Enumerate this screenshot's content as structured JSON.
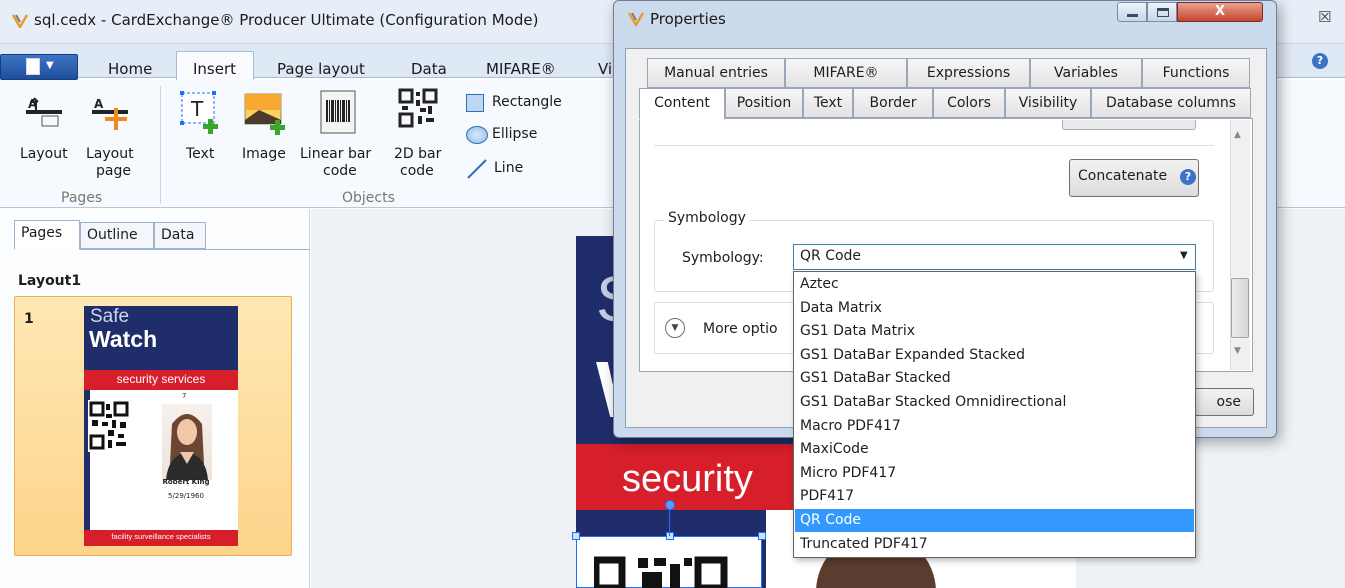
{
  "window": {
    "title": "sql.cedx - CardExchange® Producer Ultimate (Configuration Mode)"
  },
  "ribbon": {
    "tabs": [
      "Home",
      "Insert",
      "Page layout",
      "Data",
      "MIFARE®",
      "Vi"
    ],
    "active_tab": "Insert",
    "pages_group": {
      "label": "Pages",
      "layout": "Layout",
      "layout_page_1": "Layout",
      "layout_page_2": "page"
    },
    "objects_group": {
      "label": "Objects",
      "text": "Text",
      "image": "Image",
      "linear_1": "Linear bar",
      "linear_2": "code",
      "bar2d_1": "2D bar",
      "bar2d_2": "code",
      "rectangle": "Rectangle",
      "ellipse": "Ellipse",
      "line": "Line"
    }
  },
  "left_panel": {
    "tabs": [
      "Pages",
      "Outline",
      "Data"
    ],
    "layout_name": "Layout1",
    "page_number": "1",
    "card": {
      "safe": "Safe",
      "watch": "Watch",
      "band": "security services",
      "number": "7",
      "name": "Robert King",
      "date": "5/29/1960",
      "footer": "facility surveillance specialists"
    }
  },
  "canvas_card": {
    "s": "S",
    "w": "W",
    "security": "security"
  },
  "dialog": {
    "title": "Properties",
    "tabs_row1": [
      "Manual entries",
      "MIFARE®",
      "Expressions",
      "Variables",
      "Functions"
    ],
    "tabs_row2": [
      "Content",
      "Position",
      "Text",
      "Border",
      "Colors",
      "Visibility",
      "Database columns"
    ],
    "active_tab": "Content",
    "concatenate_label": "Concatenate",
    "symbology_group": "Symbology",
    "symbology_label": "Symbology:",
    "symbology_value": "QR Code",
    "more_options": "More optio",
    "close_partial": "ose",
    "dropdown_options": [
      "Aztec",
      "Data Matrix",
      "GS1 Data Matrix",
      "GS1 DataBar Expanded Stacked",
      "GS1 DataBar Stacked",
      "GS1 DataBar Stacked Omnidirectional",
      "Macro PDF417",
      "MaxiCode",
      "Micro PDF417",
      "PDF417",
      "QR Code",
      "Truncated PDF417"
    ],
    "selected_option": "QR Code"
  },
  "colors": {
    "brand_navy": "#1f2e6b",
    "brand_red": "#d71e2b",
    "selection_blue": "#3399ff",
    "thumb_highlight": "#fdd48b"
  },
  "icons": [
    "app-icon",
    "help-icon",
    "layout-icon",
    "layout-page-icon",
    "text-tool-icon",
    "image-tool-icon",
    "linear-barcode-icon",
    "2d-barcode-icon",
    "rectangle-icon",
    "ellipse-icon",
    "line-icon",
    "expand-chevron-icon",
    "close-icon"
  ]
}
